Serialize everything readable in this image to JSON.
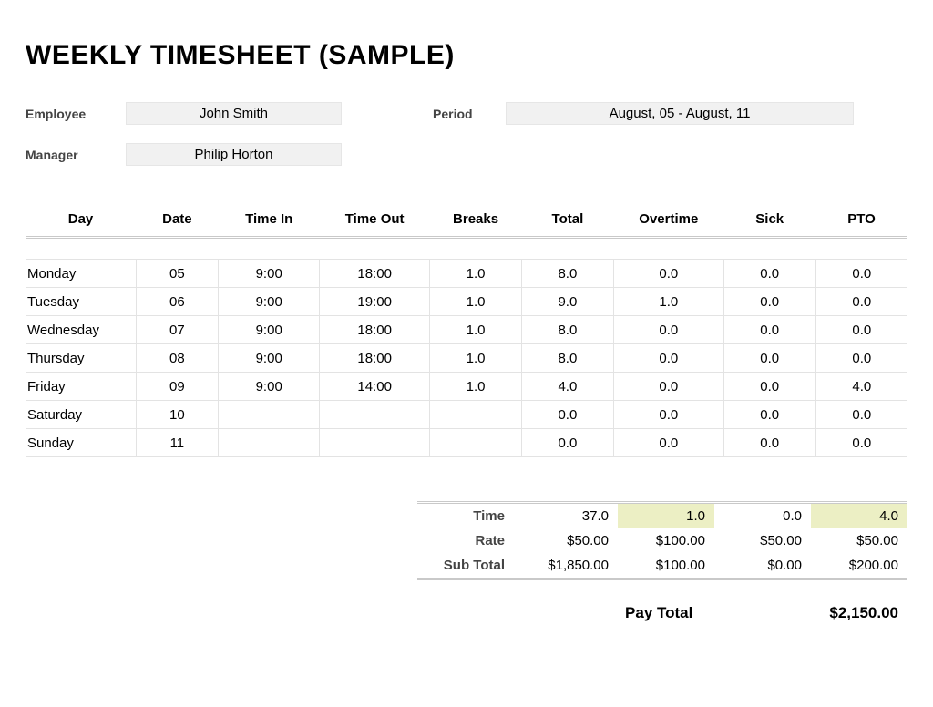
{
  "title": "WEEKLY TIMESHEET (SAMPLE)",
  "info": {
    "employee_label": "Employee",
    "employee_value": "John Smith",
    "period_label": "Period",
    "period_value": "August, 05 - August, 11",
    "manager_label": "Manager",
    "manager_value": "Philip Horton"
  },
  "columns": {
    "day": "Day",
    "date": "Date",
    "time_in": "Time In",
    "time_out": "Time Out",
    "breaks": "Breaks",
    "total": "Total",
    "overtime": "Overtime",
    "sick": "Sick",
    "pto": "PTO"
  },
  "rows": [
    {
      "day": "Monday",
      "date": "05",
      "time_in": "9:00",
      "time_out": "18:00",
      "breaks": "1.0",
      "total": "8.0",
      "overtime": "0.0",
      "sick": "0.0",
      "pto": "0.0"
    },
    {
      "day": "Tuesday",
      "date": "06",
      "time_in": "9:00",
      "time_out": "19:00",
      "breaks": "1.0",
      "total": "9.0",
      "overtime": "1.0",
      "sick": "0.0",
      "pto": "0.0"
    },
    {
      "day": "Wednesday",
      "date": "07",
      "time_in": "9:00",
      "time_out": "18:00",
      "breaks": "1.0",
      "total": "8.0",
      "overtime": "0.0",
      "sick": "0.0",
      "pto": "0.0"
    },
    {
      "day": "Thursday",
      "date": "08",
      "time_in": "9:00",
      "time_out": "18:00",
      "breaks": "1.0",
      "total": "8.0",
      "overtime": "0.0",
      "sick": "0.0",
      "pto": "0.0"
    },
    {
      "day": "Friday",
      "date": "09",
      "time_in": "9:00",
      "time_out": "14:00",
      "breaks": "1.0",
      "total": "4.0",
      "overtime": "0.0",
      "sick": "0.0",
      "pto": "4.0"
    },
    {
      "day": "Saturday",
      "date": "10",
      "time_in": "",
      "time_out": "",
      "breaks": "",
      "total": "0.0",
      "overtime": "0.0",
      "sick": "0.0",
      "pto": "0.0"
    },
    {
      "day": "Sunday",
      "date": "11",
      "time_in": "",
      "time_out": "",
      "breaks": "",
      "total": "0.0",
      "overtime": "0.0",
      "sick": "0.0",
      "pto": "0.0"
    }
  ],
  "summary": {
    "time_label": "Time",
    "rate_label": "Rate",
    "subtotal_label": "Sub Total",
    "time": {
      "total": "37.0",
      "overtime": "1.0",
      "sick": "0.0",
      "pto": "4.0"
    },
    "rate": {
      "total": "$50.00",
      "overtime": "$100.00",
      "sick": "$50.00",
      "pto": "$50.00"
    },
    "subtotal": {
      "total": "$1,850.00",
      "overtime": "$100.00",
      "sick": "$0.00",
      "pto": "$200.00"
    }
  },
  "paytotal": {
    "label": "Pay Total",
    "value": "$2,150.00"
  }
}
